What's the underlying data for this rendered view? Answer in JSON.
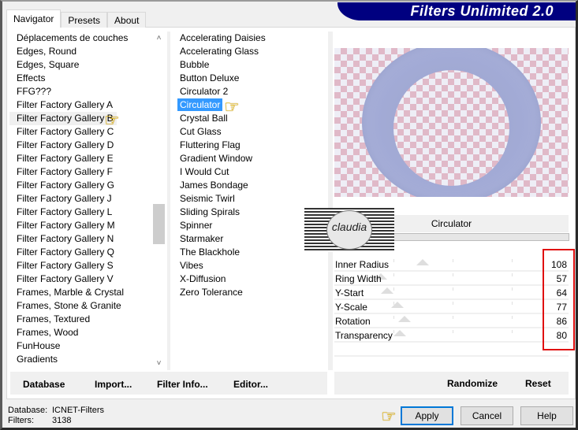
{
  "window": {
    "banner_title": "Filters Unlimited 2.0"
  },
  "tabs": [
    {
      "label": "Navigator",
      "active": true
    },
    {
      "label": "Presets",
      "active": false
    },
    {
      "label": "About",
      "active": false
    }
  ],
  "categories": {
    "items": [
      "Déplacements de couches",
      "Edges, Round",
      "Edges, Square",
      "Effects",
      "FFG???",
      "Filter Factory Gallery A",
      "Filter Factory Gallery B",
      "Filter Factory Gallery C",
      "Filter Factory Gallery D",
      "Filter Factory Gallery E",
      "Filter Factory Gallery F",
      "Filter Factory Gallery G",
      "Filter Factory Gallery J",
      "Filter Factory Gallery L",
      "Filter Factory Gallery M",
      "Filter Factory Gallery N",
      "Filter Factory Gallery Q",
      "Filter Factory Gallery S",
      "Filter Factory Gallery V",
      "Frames, Marble & Crystal",
      "Frames, Stone & Granite",
      "Frames, Textured",
      "Frames, Wood",
      "FunHouse",
      "Gradients"
    ],
    "selected": "Filter Factory Gallery B"
  },
  "filters": {
    "items": [
      "Accelerating Daisies",
      "Accelerating Glass",
      "Bubble",
      "Button Deluxe",
      "Circulator 2",
      "Circulator",
      "Crystal Ball",
      "Cut Glass",
      "Fluttering Flag",
      "Gradient Window",
      "I Would Cut",
      "James Bondage",
      "Seismic Twirl",
      "Sliding Spirals",
      "Spinner",
      "Starmaker",
      "The Blackhole",
      "Vibes",
      "X-Diffusion",
      "Zero Tolerance"
    ],
    "selected": "Circulator"
  },
  "preview": {
    "filter_name": "Circulator",
    "ring_color": "#a3abd6"
  },
  "watermark": {
    "text": "claudia"
  },
  "parameters": [
    {
      "label": "Inner Radius",
      "value": 108
    },
    {
      "label": "Ring Width",
      "value": 57
    },
    {
      "label": "Y-Start",
      "value": 64
    },
    {
      "label": "Y-Scale",
      "value": 77
    },
    {
      "label": "Rotation",
      "value": 86
    },
    {
      "label": "Transparency",
      "value": 80
    }
  ],
  "parameter_range": [
    0,
    255
  ],
  "left_buttons": {
    "database": "Database",
    "import": "Import...",
    "filter_info": "Filter Info...",
    "editor": "Editor..."
  },
  "right_buttons": {
    "randomize": "Randomize",
    "reset": "Reset"
  },
  "status": {
    "database_label": "Database:",
    "database_value": "ICNET-Filters",
    "filters_label": "Filters:",
    "filters_value": "3138"
  },
  "dialog_buttons": {
    "apply": "Apply",
    "cancel": "Cancel",
    "help": "Help"
  },
  "colors": {
    "banner": "#000080",
    "selection": "#3399ff",
    "highlight_box": "#e01010",
    "default_button_border": "#0078d7"
  }
}
